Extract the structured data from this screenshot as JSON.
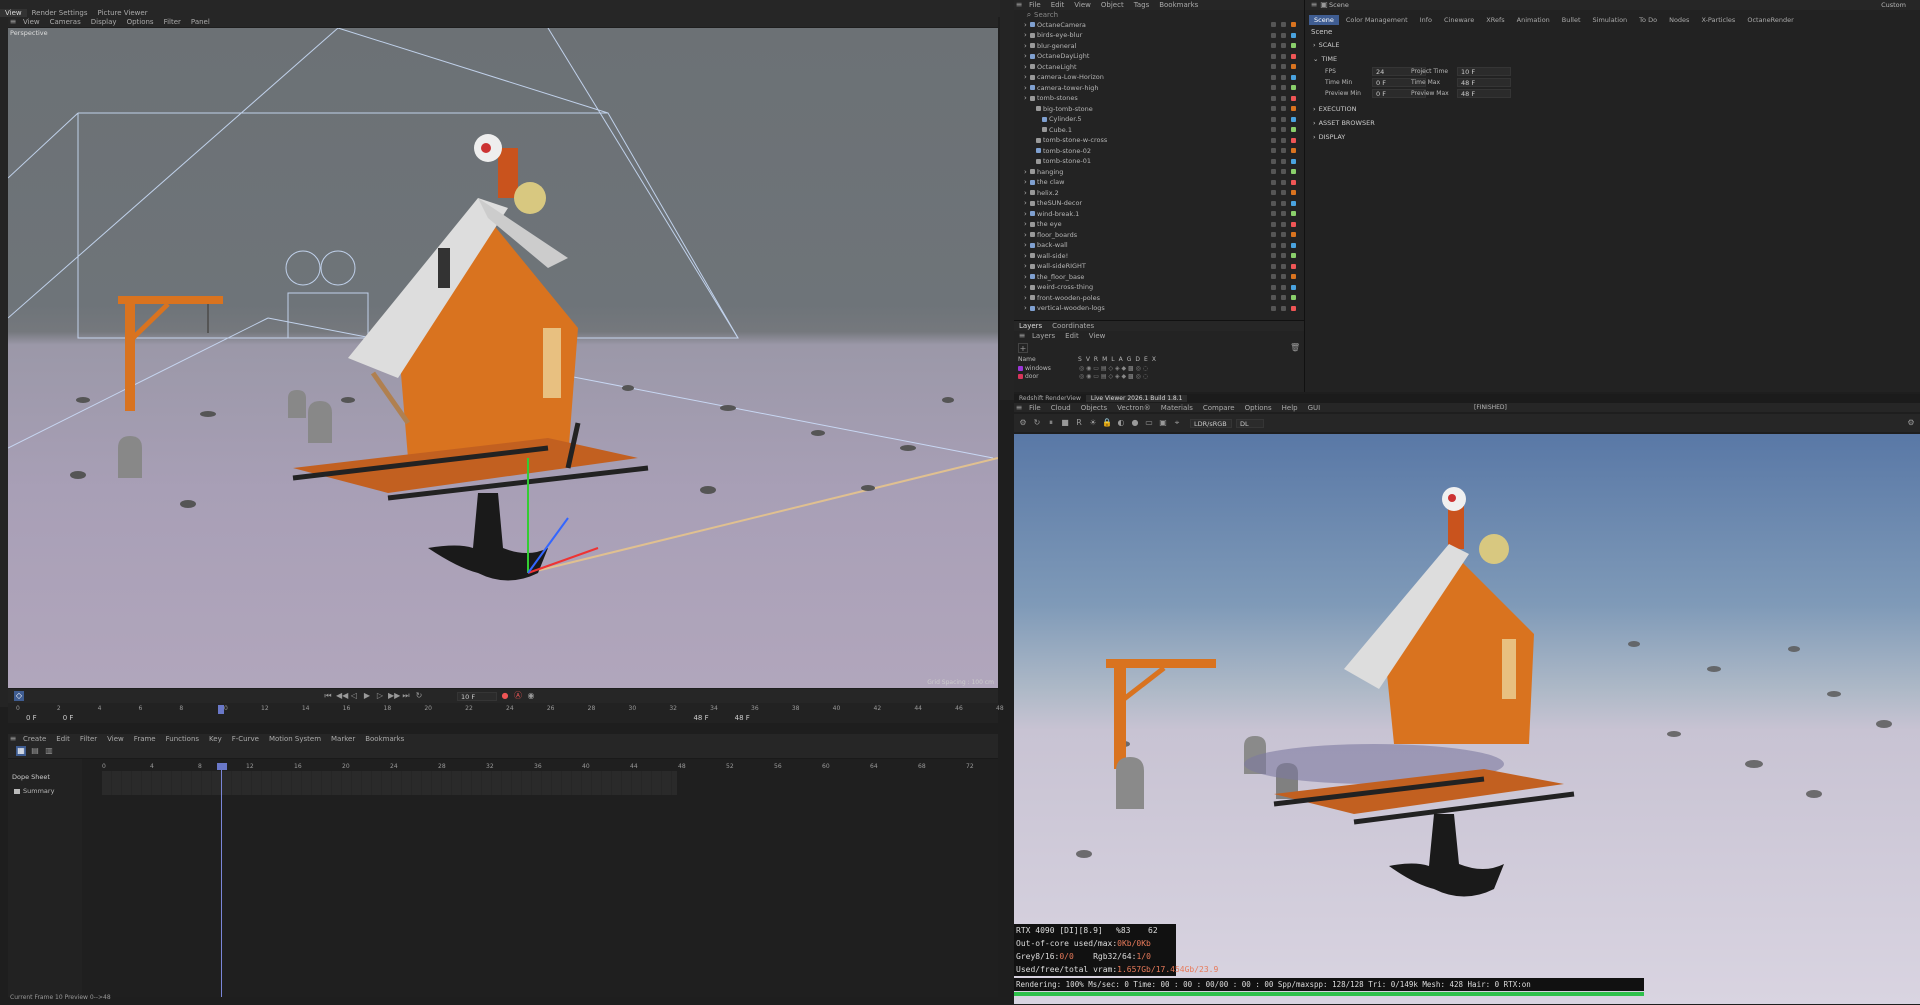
{
  "top_menu": {
    "tabs": [
      "View",
      "Render Settings",
      "Picture Viewer"
    ],
    "right_label": "Custom"
  },
  "viewport": {
    "menu": [
      "View",
      "Cameras",
      "Display",
      "Options",
      "Filter",
      "Panel"
    ],
    "label": "Perspective",
    "grid_spacing": "Grid Spacing : 100 cm"
  },
  "timeline": {
    "frame_field": "10 F",
    "start": "0 F",
    "start2": "0 F",
    "end": "48 F",
    "end2": "48 F",
    "ticks": [
      "0",
      "2",
      "4",
      "6",
      "8",
      "10",
      "12",
      "14",
      "16",
      "18",
      "20",
      "22",
      "24",
      "26",
      "28",
      "30",
      "32",
      "34",
      "36",
      "38",
      "40",
      "42",
      "44",
      "46",
      "48"
    ]
  },
  "dope": {
    "menu": [
      "Create",
      "Edit",
      "Filter",
      "View",
      "Frame",
      "Functions",
      "Key",
      "F-Curve",
      "Motion System",
      "Marker",
      "Bookmarks"
    ],
    "label": "Dope Sheet",
    "summary": "Summary",
    "ticks": [
      "0",
      "4",
      "8",
      "12",
      "16",
      "20",
      "24",
      "28",
      "32",
      "36",
      "40",
      "44",
      "48",
      "52",
      "56",
      "60",
      "64",
      "68",
      "72"
    ],
    "status": "Current Frame  10  Preview  0-->48"
  },
  "object_manager": {
    "menu": [
      "File",
      "Edit",
      "View",
      "Object",
      "Tags",
      "Bookmarks"
    ],
    "search": "Search",
    "objects": [
      {
        "name": "OctaneCamera",
        "indent": 0
      },
      {
        "name": "birds-eye-blur",
        "indent": 0
      },
      {
        "name": "blur-general",
        "indent": 0
      },
      {
        "name": "OctaneDayLight",
        "indent": 0
      },
      {
        "name": "OctaneLight",
        "indent": 0
      },
      {
        "name": "camera-Low-Horizon",
        "indent": 0
      },
      {
        "name": "camera-tower-high",
        "indent": 0
      },
      {
        "name": "tomb-stones",
        "indent": 0
      },
      {
        "name": "big-tomb-stone",
        "indent": 1
      },
      {
        "name": "Cylinder.5",
        "indent": 2
      },
      {
        "name": "Cube.1",
        "indent": 2
      },
      {
        "name": "tomb-stone-w-cross",
        "indent": 1
      },
      {
        "name": "tomb-stone-02",
        "indent": 1
      },
      {
        "name": "tomb-stone-01",
        "indent": 1
      },
      {
        "name": "hanging",
        "indent": 0
      },
      {
        "name": "the claw",
        "indent": 0
      },
      {
        "name": "helix.2",
        "indent": 0
      },
      {
        "name": "theSUN-decor",
        "indent": 0
      },
      {
        "name": "wind-break.1",
        "indent": 0
      },
      {
        "name": "the eye",
        "indent": 0
      },
      {
        "name": "floor_boards",
        "indent": 0
      },
      {
        "name": "back-wall",
        "indent": 0
      },
      {
        "name": "wall-side!",
        "indent": 0
      },
      {
        "name": "wall-sideRIGHT",
        "indent": 0
      },
      {
        "name": "the_floor_base",
        "indent": 0
      },
      {
        "name": "weird-cross-thing",
        "indent": 0
      },
      {
        "name": "front-wooden-poles",
        "indent": 0
      },
      {
        "name": "vertical-wooden-logs",
        "indent": 0
      }
    ]
  },
  "layers": {
    "tabs": [
      "Layers",
      "Coordinates"
    ],
    "menu": [
      "Layers",
      "Edit",
      "View"
    ],
    "col_name": "Name",
    "cols": [
      "S",
      "V",
      "R",
      "M",
      "L",
      "A",
      "G",
      "D",
      "E",
      "X"
    ],
    "rows": [
      {
        "name": "windows",
        "color": "#9b35d8"
      },
      {
        "name": "door",
        "color": "#d8355a"
      }
    ]
  },
  "attributes": {
    "title": "Scene",
    "tabs": [
      "Scene",
      "Color Management",
      "Info",
      "Cineware",
      "XRefs",
      "Animation",
      "Bullet",
      "Simulation",
      "To Do",
      "Nodes",
      "X-Particles",
      "OctaneRender"
    ],
    "heading": "Scene",
    "sections": {
      "scale": "SCALE",
      "time": "TIME",
      "execution": "EXECUTION",
      "asset_browser": "ASSET BROWSER",
      "display": "DISPLAY"
    },
    "time": {
      "fps_label": "FPS",
      "fps": "24",
      "project_time_label": "Project Time",
      "project_time": "10 F",
      "time_min_label": "Time Min",
      "time_min": "0 F",
      "time_max_label": "Time Max",
      "time_max": "48 F",
      "preview_min_label": "Preview Min",
      "preview_min": "0 F",
      "preview_max_label": "Preview Max",
      "preview_max": "48 F"
    }
  },
  "render": {
    "tabs": [
      "Redshift RenderView",
      "Live Viewer 2026.1 Build 1.8.1"
    ],
    "menu": [
      "File",
      "Cloud",
      "Objects",
      "Vectron®",
      "Materials",
      "Compare",
      "Options",
      "Help",
      "GUI"
    ],
    "status": "[FINISHED]",
    "lut": "LDR/sRGB",
    "dl": "DL",
    "stats": {
      "gpu": "RTX 4090 [DI][8.9]",
      "gpu_pct": "%83",
      "gpu_temp": "62",
      "ooc_label": "Out-of-core used/max:",
      "ooc_val": "0Kb/0Kb",
      "grey_label": "Grey8/16:",
      "grey_val": "0/0",
      "rgb_label": "Rgb32/64:",
      "rgb_val": "1/0",
      "vram_label": "Used/free/total vram:",
      "vram_val": "1.657Gb/17.454Gb/23.9",
      "render_line": "Rendering: 100%  Ms/sec: 0   Time: 00 : 00 : 00/00 : 00 : 00   Spp/maxspp: 128/128   Tri: 0/149k   Mesh: 428   Hair: 0   RTX:on"
    },
    "progress": 1.0
  },
  "colors": {
    "accent": "#3f5d92",
    "orange": "#d9731f",
    "green": "#2ec04a"
  }
}
